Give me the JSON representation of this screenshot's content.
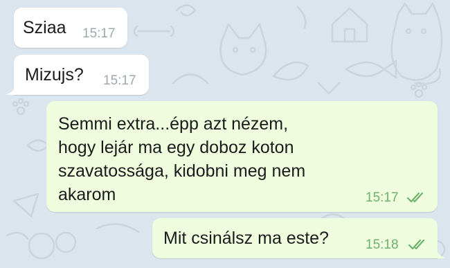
{
  "messages": [
    {
      "direction": "incoming",
      "text": "Sziaa",
      "time": "15:17"
    },
    {
      "direction": "incoming",
      "text": "Mizujs?",
      "time": "15:17"
    },
    {
      "direction": "outgoing",
      "lines": [
        "Semmi extra...épp azt nézem,",
        "hogy lejár ma egy doboz koton",
        "szavatossága, kidobni meg nem",
        "akarom"
      ],
      "time": "15:17",
      "status": "read"
    },
    {
      "direction": "outgoing",
      "text": "Mit csinálsz ma este?",
      "time": "15:18",
      "status": "read"
    }
  ],
  "colors": {
    "background": "#dbe5ed",
    "incoming_bubble": "#ffffff",
    "outgoing_bubble": "#effdde",
    "read_check": "#6cb16c"
  },
  "icons": [
    "double-check-icon",
    "wallpaper-doodles"
  ]
}
